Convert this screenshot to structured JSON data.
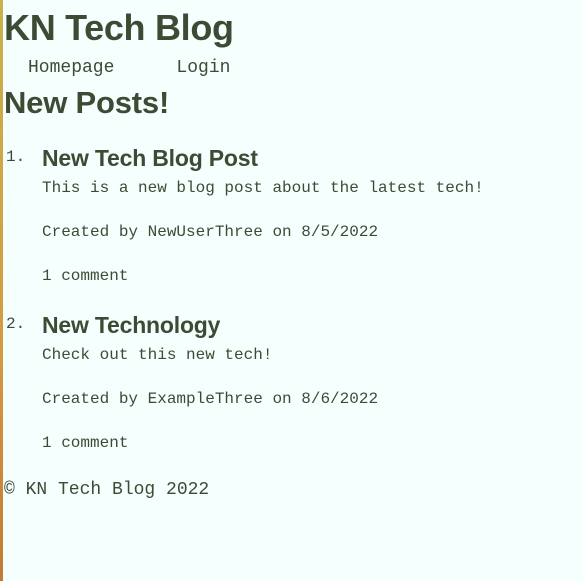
{
  "header": {
    "site_title": "KN Tech Blog"
  },
  "nav": {
    "homepage_label": "Homepage",
    "login_label": "Login"
  },
  "main": {
    "section_title": "New Posts!",
    "posts": [
      {
        "number": "1.",
        "title": "New Tech Blog Post",
        "body": "This is a new blog post about the latest tech!",
        "meta": "Created by NewUserThree on 8/5/2022",
        "comments": "1 comment"
      },
      {
        "number": "2.",
        "title": "New Technology",
        "body": "Check out this new tech!",
        "meta": "Created by ExampleThree on 8/6/2022",
        "comments": "1 comment"
      }
    ]
  },
  "footer": {
    "copyright": "© KN Tech Blog 2022"
  }
}
